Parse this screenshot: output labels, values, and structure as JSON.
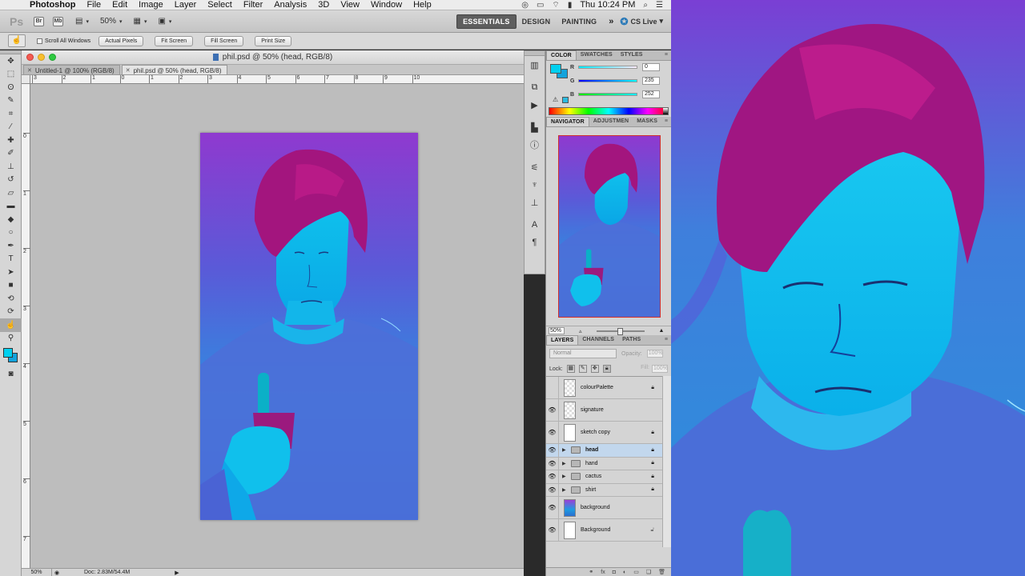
{
  "menubar": {
    "app_name": "Photoshop",
    "items": [
      "File",
      "Edit",
      "Image",
      "Layer",
      "Select",
      "Filter",
      "Analysis",
      "3D",
      "View",
      "Window",
      "Help"
    ],
    "clock": "Thu 10:24 PM"
  },
  "appbar": {
    "logo": "Ps",
    "zoom": "50%",
    "workspaces": [
      "ESSENTIALS",
      "DESIGN",
      "PAINTING"
    ],
    "more": "»",
    "cslive": "CS Live"
  },
  "options": {
    "scroll_all": "Scroll All Windows",
    "buttons": [
      "Actual Pixels",
      "Fit Screen",
      "Fill Screen",
      "Print Size"
    ]
  },
  "document": {
    "title": "phil.psd @ 50% (head, RGB/8)",
    "tabs": [
      "Untitled-1 @ 100% (RGB/8)",
      "phil.psd @ 50% (head, RGB/8)"
    ],
    "ruler_h_labels": [
      "3",
      "2",
      "1",
      "0",
      "1",
      "2",
      "3",
      "4",
      "5",
      "6",
      "7",
      "8",
      "9",
      "10"
    ],
    "ruler_v_labels": [
      "0",
      "1",
      "2",
      "3",
      "4",
      "5",
      "6",
      "7"
    ],
    "status_zoom": "50%",
    "status_doc": "Doc: 2.83M/54.4M"
  },
  "color_panel": {
    "tabs": [
      "COLOR",
      "SWATCHES",
      "STYLES"
    ],
    "r_label": "R",
    "g_label": "G",
    "b_label": "B",
    "r": "0",
    "g": "235",
    "b": "252"
  },
  "navigator": {
    "tabs": [
      "NAVIGATOR",
      "ADJUSTMEN",
      "MASKS"
    ],
    "zoom": "50%"
  },
  "layers_panel": {
    "tabs": [
      "LAYERS",
      "CHANNELS",
      "PATHS"
    ],
    "blend_mode": "Normal",
    "opacity_label": "Opacity:",
    "opacity": "100%",
    "lock_label": "Lock:",
    "fill_label": "Fill:",
    "fill": "100%",
    "layers": [
      {
        "name": "colourPalette",
        "kind": "layer",
        "visible": false,
        "locked": true
      },
      {
        "name": "signature",
        "kind": "layer",
        "visible": true,
        "locked": false
      },
      {
        "name": "sketch copy",
        "kind": "layer",
        "visible": true,
        "locked": true
      },
      {
        "name": "head",
        "kind": "group",
        "visible": true,
        "locked": true,
        "selected": true
      },
      {
        "name": "hand",
        "kind": "group",
        "visible": true,
        "locked": true
      },
      {
        "name": "cactus",
        "kind": "group",
        "visible": true,
        "locked": true
      },
      {
        "name": "shirt",
        "kind": "group",
        "visible": true,
        "locked": true
      },
      {
        "name": "background",
        "kind": "layer",
        "visible": true,
        "locked": false
      },
      {
        "name": "Background",
        "kind": "layer",
        "visible": true,
        "locked": true
      }
    ]
  },
  "colors": {
    "foreground": "#00d0ef",
    "background": "#13a3dc",
    "art_blue": "#1e9be0",
    "art_purple": "#8a2fc8",
    "hair": "#a3157e"
  }
}
